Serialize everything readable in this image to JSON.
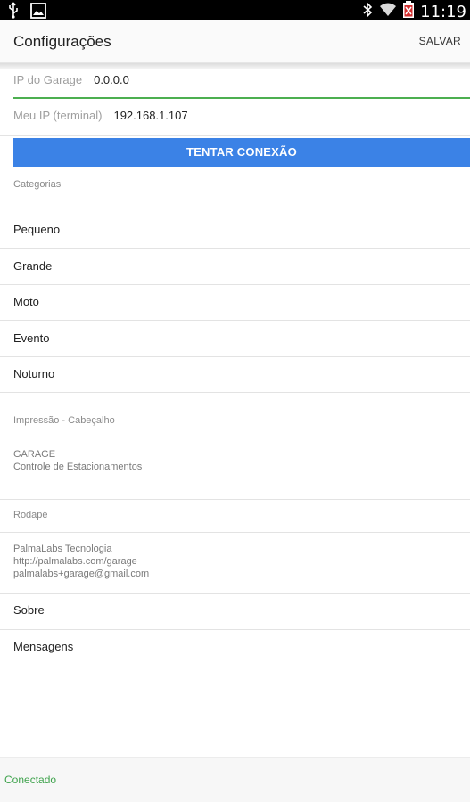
{
  "status_bar": {
    "time": "11:19",
    "icons": [
      "usb-icon",
      "image-icon",
      "bluetooth-icon",
      "wifi-icon",
      "battery-icon"
    ]
  },
  "app_bar": {
    "title": "Configurações",
    "save_label": "SALVAR"
  },
  "connection": {
    "ip_garage_label": "IP do Garage",
    "ip_garage_value": "0.0.0.0",
    "ip_terminal_label": "Meu IP (terminal)",
    "ip_terminal_value": "192.168.1.107",
    "connect_button": "TENTAR CONEXÃO",
    "focus_color": "#4caf50",
    "button_color": "#3b82e6"
  },
  "categories": {
    "label": "Categorias",
    "items": [
      "Pequeno",
      "Grande",
      "Moto",
      "Evento",
      "Noturno"
    ]
  },
  "print_header": {
    "label": "Impressão - Cabeçalho",
    "lines": [
      "GARAGE",
      "Controle de Estacionamentos"
    ]
  },
  "footer": {
    "label": "Rodapé",
    "lines": [
      "PalmaLabs Tecnologia",
      "http://palmalabs.com/garage",
      "palmalabs+garage@gmail.com"
    ]
  },
  "menu": {
    "about": "Sobre",
    "messages": "Mensagens"
  },
  "bottom_status": {
    "text": "Conectado",
    "color": "#3fa34d"
  }
}
